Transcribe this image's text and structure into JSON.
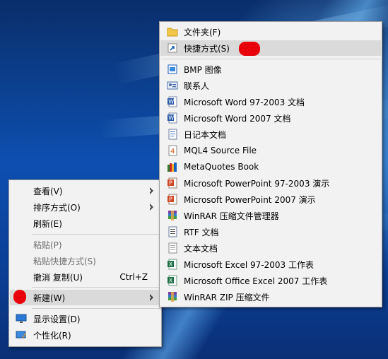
{
  "colors": {
    "menu_bg": "#f2f2f2",
    "highlight": "#dadada",
    "annotation": "#e8000a",
    "desktop": "#0d4fb0"
  },
  "desktop_menu": {
    "items": [
      {
        "label": "查看(V)",
        "submenu": true
      },
      {
        "label": "排序方式(O)",
        "submenu": true
      },
      {
        "label": "刷新(E)"
      },
      {
        "label": "粘贴(P)",
        "disabled": true
      },
      {
        "label": "粘贴快捷方式(S)",
        "disabled": true
      },
      {
        "label": "撤消 复制(U)",
        "shortcut": "Ctrl+Z"
      },
      {
        "label": "新建(W)",
        "submenu": true,
        "highlighted": true
      },
      {
        "label": "显示设置(D)",
        "icon": "display-settings-icon"
      },
      {
        "label": "个性化(R)",
        "icon": "personalize-icon"
      }
    ]
  },
  "new_submenu": {
    "items": [
      {
        "label": "文件夹(F)",
        "icon": "folder-icon"
      },
      {
        "label": "快捷方式(S)",
        "icon": "shortcut-icon",
        "highlighted": true
      },
      {
        "label": "BMP 图像",
        "icon": "bmp-image-icon"
      },
      {
        "label": "联系人",
        "icon": "contact-icon"
      },
      {
        "label": "Microsoft Word 97-2003 文档",
        "icon": "word-doc-icon"
      },
      {
        "label": "Microsoft Word 2007 文档",
        "icon": "word-docx-icon"
      },
      {
        "label": "日记本文档",
        "icon": "journal-icon"
      },
      {
        "label": "MQL4 Source File",
        "icon": "mql4-icon"
      },
      {
        "label": "MetaQuotes Book",
        "icon": "metaquotes-book-icon"
      },
      {
        "label": "Microsoft PowerPoint 97-2003 演示",
        "icon": "powerpoint-ppt-icon"
      },
      {
        "label": "Microsoft PowerPoint 2007 演示",
        "icon": "powerpoint-pptx-icon"
      },
      {
        "label": "WinRAR 压缩文件管理器",
        "icon": "winrar-icon"
      },
      {
        "label": "RTF 文档",
        "icon": "rtf-icon"
      },
      {
        "label": "文本文档",
        "icon": "text-doc-icon"
      },
      {
        "label": "Microsoft Excel 97-2003 工作表",
        "icon": "excel-xls-icon"
      },
      {
        "label": "Microsoft Office Excel 2007 工作表",
        "icon": "excel-xlsx-icon"
      },
      {
        "label": "WinRAR ZIP 压缩文件",
        "icon": "winrar-zip-icon"
      }
    ]
  }
}
